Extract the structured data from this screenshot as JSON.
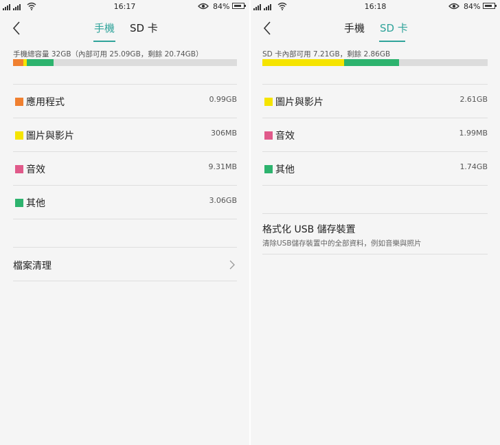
{
  "colors": {
    "accent": "#2fa39a",
    "apps": "#f08030",
    "media": "#f5e400",
    "audio": "#e05a8a",
    "other": "#2db36e",
    "bar_bg": "#dcdcdc"
  },
  "left": {
    "status": {
      "time": "16:17",
      "battery": "84%"
    },
    "tabs": [
      {
        "label": "手機",
        "active": true
      },
      {
        "label": "SD 卡",
        "active": false
      }
    ],
    "capacity_text": "手機總容量 32GB（內部可用 25.09GB，剩餘 20.74GB）",
    "usage_fractions": {
      "apps": 0.045,
      "media": 0.015,
      "other": 0.12
    },
    "items": [
      {
        "label": "應用程式",
        "value": "0.99GB",
        "color": "#f08030"
      },
      {
        "label": "圖片與影片",
        "value": "306MB",
        "color": "#f5e400"
      },
      {
        "label": "音效",
        "value": "9.31MB",
        "color": "#e05a8a"
      },
      {
        "label": "其他",
        "value": "3.06GB",
        "color": "#2db36e"
      }
    ],
    "file_cleanup_label": "檔案清理"
  },
  "right": {
    "status": {
      "time": "16:18",
      "battery": "84%"
    },
    "tabs": [
      {
        "label": "手機",
        "active": false
      },
      {
        "label": "SD 卡",
        "active": true
      }
    ],
    "capacity_text": "SD 卡內部可用 7.21GB，剩餘 2.86GB",
    "usage_fractions": {
      "media": 0.362,
      "other": 0.245
    },
    "items": [
      {
        "label": "圖片與影片",
        "value": "2.61GB",
        "color": "#f5e400"
      },
      {
        "label": "音效",
        "value": "1.99MB",
        "color": "#e05a8a"
      },
      {
        "label": "其他",
        "value": "1.74GB",
        "color": "#2db36e"
      }
    ],
    "format_usb": {
      "title": "格式化 USB 儲存裝置",
      "subtitle": "清除USB儲存裝置中的全部資料，例如音樂與照片"
    }
  }
}
